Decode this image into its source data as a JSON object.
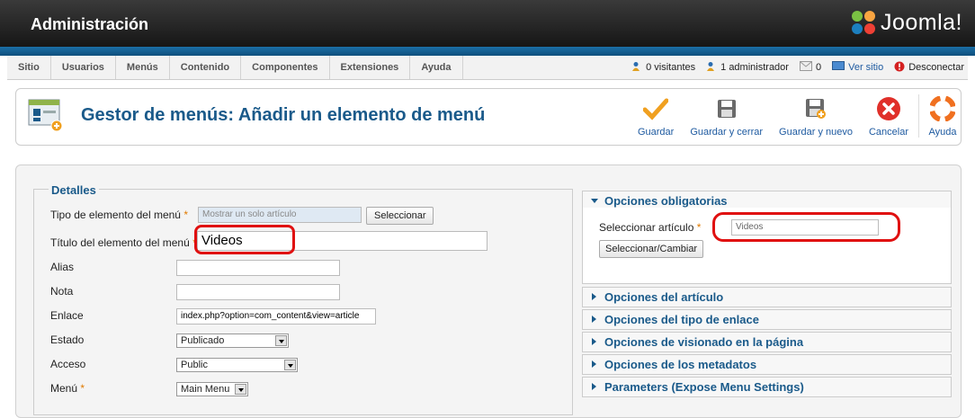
{
  "header": {
    "title": "Administración",
    "brand": "Joomla!"
  },
  "menu": [
    "Sitio",
    "Usuarios",
    "Menús",
    "Contenido",
    "Componentes",
    "Extensiones",
    "Ayuda"
  ],
  "status": {
    "visitors": "0 visitantes",
    "admins": "1 administrador",
    "messages": "0",
    "view_site": "Ver sitio",
    "logout": "Desconectar"
  },
  "toolbar": {
    "page_title": "Gestor de menús: Añadir un elemento de menú",
    "save": "Guardar",
    "save_close": "Guardar y cerrar",
    "save_new": "Guardar y nuevo",
    "cancel": "Cancelar",
    "help": "Ayuda"
  },
  "details": {
    "legend": "Detalles",
    "type_label": "Tipo de elemento del menú",
    "type_value": "Mostrar un solo artículo",
    "select_button": "Seleccionar",
    "title_label": "Título del elemento del menú",
    "title_value": "Videos",
    "alias_label": "Alias",
    "alias_value": "",
    "note_label": "Nota",
    "note_value": "",
    "link_label": "Enlace",
    "link_value": "index.php?option=com_content&view=article",
    "state_label": "Estado",
    "state_value": "Publicado",
    "access_label": "Acceso",
    "access_value": "Public",
    "menu_label": "Menú",
    "menu_value": "Main Menu",
    "required_mark": "*"
  },
  "required_options": {
    "title": "Opciones obligatorias",
    "article_label": "Seleccionar artículo",
    "article_value": "Videos",
    "change_button": "Seleccionar/Cambiar"
  },
  "panels": [
    "Opciones del artículo",
    "Opciones del tipo de enlace",
    "Opciones de visionado en la página",
    "Opciones de los metadatos",
    "Parameters (Expose Menu Settings)"
  ],
  "colors": {
    "accent": "#1a5a8a",
    "highlight": "#e01010",
    "required": "#e07a00"
  }
}
